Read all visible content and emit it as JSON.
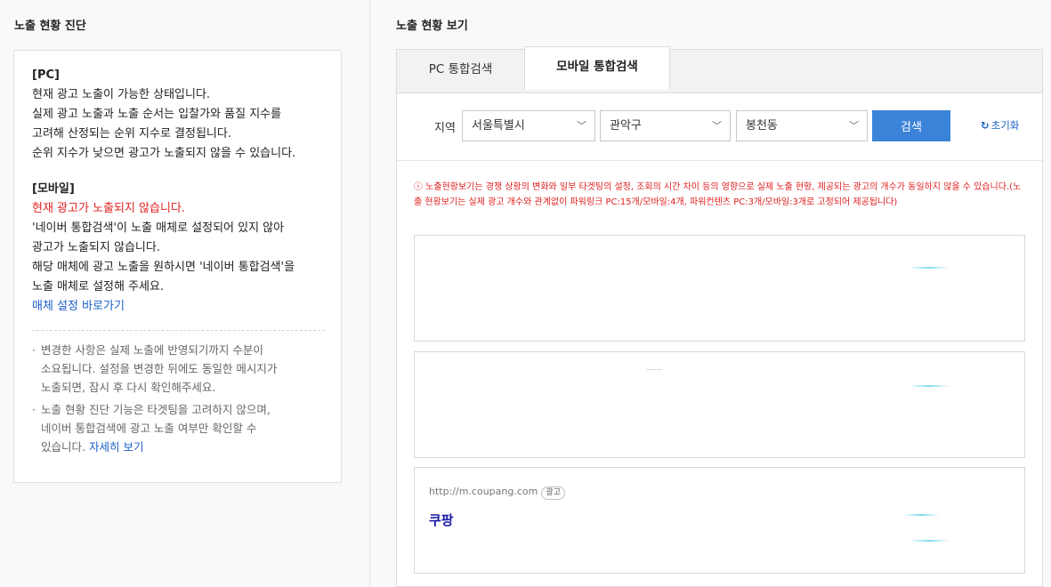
{
  "left": {
    "title": "노출 현황 진단",
    "pc": {
      "heading": "[PC]",
      "lines": [
        "현재 광고 노출이 가능한 상태입니다.",
        "실제 광고 노출과 노출 순서는 입찰가와 품질 지수를",
        "고려해 산정되는 순위 지수로 결정됩니다.",
        "순위 지수가 낮으면 광고가 노출되지 않을 수 있습니다."
      ]
    },
    "mobile": {
      "heading": "[모바일]",
      "status": "현재 광고가 노출되지 않습니다.",
      "lines": [
        "'네이버 통합검색'이 노출 매체로 설정되어 있지 않아",
        "광고가 노출되지 않습니다.",
        "해당 매체에 광고 노출을 원하시면 '네이버 통합검색'을",
        "노출 매체로 설정해 주세요."
      ],
      "link": "매체 설정 바로가기"
    },
    "notes": [
      {
        "lines": [
          "변경한 사항은 실제 노출에 반영되기까지 수분이",
          "소요됩니다. 설정을 변경한 뒤에도 동일한 메시지가",
          "노출되면, 잠시 후 다시 확인해주세요."
        ]
      },
      {
        "lines": [
          "노출 현황 진단 기능은 타겟팅을 고려하지 않으며,",
          "네이버 통합검색에 광고 노출 여부만 확인할 수"
        ],
        "last_prefix": "있습니다.",
        "link": "자세히 보기"
      }
    ]
  },
  "right": {
    "title": "노출 현황 보기",
    "tabs": [
      {
        "label": "PC 통합검색",
        "active": false
      },
      {
        "label": "모바일 통합검색",
        "active": true
      }
    ],
    "filter": {
      "region_label": "지역",
      "city": "서울특별시",
      "district": "관악구",
      "neighborhood": "봉천동",
      "search_label": "검색",
      "reset_label": "초기화"
    },
    "warning": "ⓘ 노출현황보기는 경쟁 상황의 변화와 일부 타겟팅의 설정, 조회의 시간 차이 등의 영향으로 실제 노출 현황, 제공되는 광고의 개수가 동일하지 않을 수 있습니다.(노출 현황보기는 실제 광고 개수와 관계없이 파워링크 PC:15개/모바일:4개, 파워컨텐츠 PC:3개/모바일:3개로 고정되어 제공됩니다)",
    "ads": [
      {
        "url": "",
        "badge": "",
        "title": ""
      },
      {
        "url": "",
        "badge": "",
        "title": ""
      },
      {
        "url": "http://m.coupang.com",
        "badge": "광고",
        "title": "쿠팡"
      }
    ]
  },
  "colors": {
    "accent_blue": "#3a83d8",
    "link_blue": "#1a5fc7",
    "warning_red": "#e02020",
    "ad_title": "#1a1aa8"
  },
  "icons": {
    "chevron": "chevron-down-icon",
    "reset": "refresh-icon",
    "info": "info-circle-icon"
  }
}
